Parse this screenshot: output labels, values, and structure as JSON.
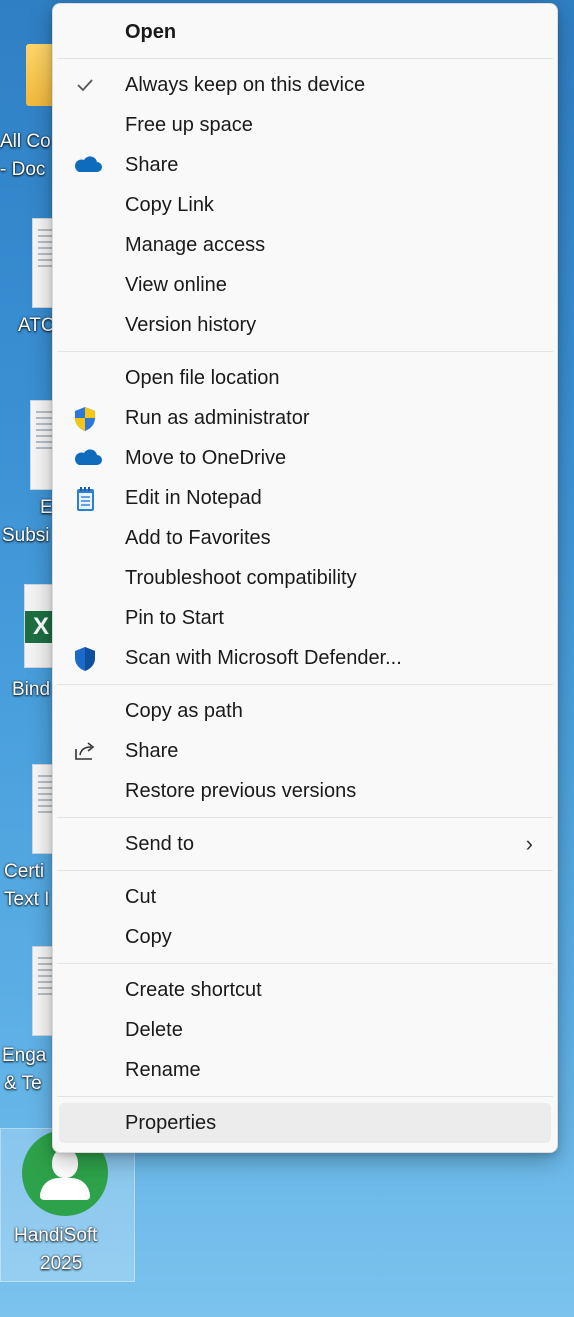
{
  "desktop": {
    "icons": [
      {
        "label_line1": "All Co",
        "label_line2": "- Doc"
      },
      {
        "label_line1": "ATC"
      },
      {
        "label_line1": "E",
        "label_line2": "Subsi"
      },
      {
        "label_line1": "Bind"
      },
      {
        "label_line1": "Certi",
        "label_line2": "Text I"
      },
      {
        "label_line1": "Enga",
        "label_line2": "& Te"
      },
      {
        "label_line1": "HandiSoft",
        "label_line2": "2025"
      }
    ]
  },
  "context_menu": {
    "groups": [
      [
        {
          "label": "Open",
          "bold": true,
          "icon": ""
        }
      ],
      [
        {
          "label": "Always keep on this device",
          "icon": "checkmark-icon"
        },
        {
          "label": "Free up space",
          "icon": ""
        },
        {
          "label": "Share",
          "icon": "onedrive-cloud-icon"
        },
        {
          "label": "Copy Link",
          "icon": ""
        },
        {
          "label": "Manage access",
          "icon": ""
        },
        {
          "label": "View online",
          "icon": ""
        },
        {
          "label": "Version history",
          "icon": ""
        }
      ],
      [
        {
          "label": "Open file location",
          "icon": ""
        },
        {
          "label": "Run as administrator",
          "icon": "uac-shield-icon"
        },
        {
          "label": "Move to OneDrive",
          "icon": "onedrive-cloud-icon"
        },
        {
          "label": "Edit in Notepad",
          "icon": "notepad-icon"
        },
        {
          "label": "Add to Favorites",
          "icon": ""
        },
        {
          "label": "Troubleshoot compatibility",
          "icon": ""
        },
        {
          "label": "Pin to Start",
          "icon": ""
        },
        {
          "label": "Scan with Microsoft Defender...",
          "icon": "defender-shield-icon"
        }
      ],
      [
        {
          "label": "Copy as path",
          "icon": ""
        },
        {
          "label": "Share",
          "icon": "share-arrow-icon"
        },
        {
          "label": "Restore previous versions",
          "icon": ""
        }
      ],
      [
        {
          "label": "Send to",
          "icon": "",
          "submenu": true
        }
      ],
      [
        {
          "label": "Cut",
          "icon": ""
        },
        {
          "label": "Copy",
          "icon": ""
        }
      ],
      [
        {
          "label": "Create shortcut",
          "icon": ""
        },
        {
          "label": "Delete",
          "icon": ""
        },
        {
          "label": "Rename",
          "icon": ""
        }
      ],
      [
        {
          "label": "Properties",
          "icon": "",
          "hovered": true
        }
      ]
    ],
    "submenu_arrow": "›"
  },
  "colors": {
    "menu_bg": "#f9f9f9",
    "onedrive_blue": "#0f6cbd",
    "defender_blue": "#1b6ac9",
    "hover_bg": "#ececec"
  }
}
